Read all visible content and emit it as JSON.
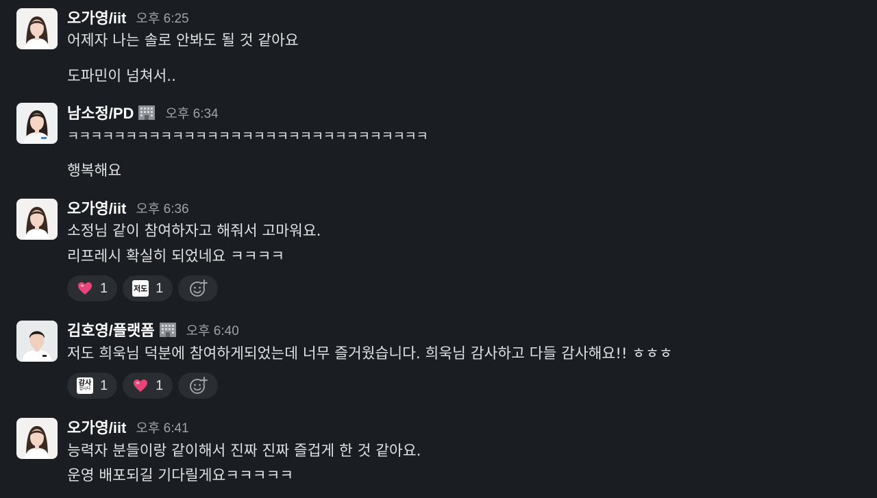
{
  "messages": [
    {
      "author": "오가영/iit",
      "time": "오후 6:25",
      "lines": [
        "어제자 나는 솔로 안봐도 될 것 같아요",
        "도파민이 넘쳐서.."
      ]
    },
    {
      "author": "남소정/PD",
      "author_icon": "building-icon",
      "time": "오후 6:34",
      "lines": [
        "ㅋㅋㅋㅋㅋㅋㅋㅋㅋㅋㅋㅋㅋㅋㅋㅋㅋㅋㅋㅋㅋㅋㅋㅋㅋㅋㅋㅋㅋㅋㅋ",
        "행복해요"
      ]
    },
    {
      "author": "오가영/iit",
      "time": "오후 6:36",
      "lines": [
        "소정님 같이 참여하자고 해줘서 고마워요.",
        "리프레시 확실히 되었네요 ㅋㅋㅋㅋ"
      ],
      "reactions": [
        {
          "emoji": "heart-emoji",
          "count": "1"
        },
        {
          "emoji": "jeodo-emoji",
          "emoji_text": "저도",
          "count": "1"
        }
      ]
    },
    {
      "author": "김호영/플랫폼",
      "author_icon": "building-icon",
      "time": "오후 6:40",
      "lines": [
        "저도 희욱님 덕분에 참여하게되었는데 너무 즐거웠습니다. 희욱님 감사하고 다들 감사해요!! ㅎㅎㅎ"
      ],
      "reactions": [
        {
          "emoji": "gamsa-emoji",
          "emoji_text_top": "감사",
          "emoji_text_bottom": "합니다",
          "count": "1"
        },
        {
          "emoji": "heart-emoji",
          "count": "1"
        }
      ]
    },
    {
      "author": "오가영/iit",
      "time": "오후 6:41",
      "lines": [
        "능력자 분들이랑 같이해서 진짜 진짜 즐겁게 한 것 같아요.",
        "운영 배포되길 기다릴게요ㅋㅋㅋㅋㅋ"
      ]
    }
  ],
  "colors": {
    "background": "#1a1d21",
    "name": "#ffffff",
    "timestamp": "#a0a2a6",
    "text": "#e0e1e2",
    "reaction_bg": "#2a2d31",
    "heart": "#e8457a"
  }
}
